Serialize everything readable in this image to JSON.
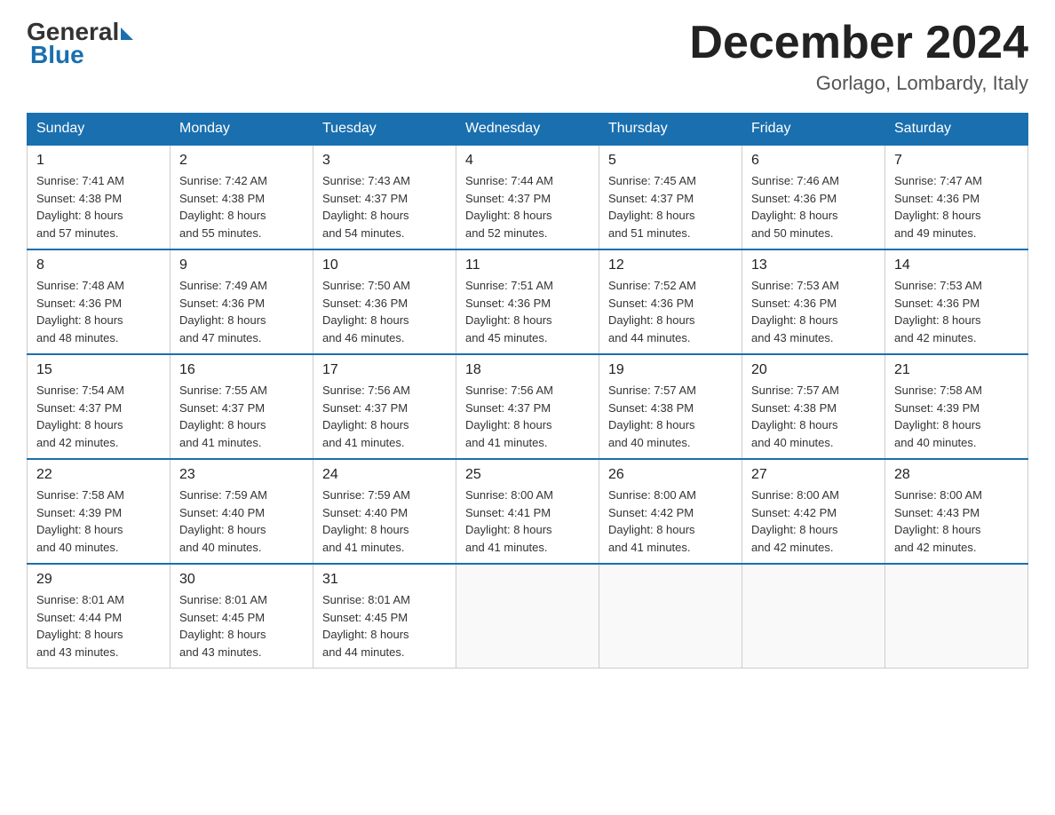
{
  "header": {
    "logo_general": "General",
    "logo_blue": "Blue",
    "month_title": "December 2024",
    "location": "Gorlago, Lombardy, Italy"
  },
  "days_of_week": [
    "Sunday",
    "Monday",
    "Tuesday",
    "Wednesday",
    "Thursday",
    "Friday",
    "Saturday"
  ],
  "weeks": [
    [
      {
        "num": "1",
        "sunrise": "7:41 AM",
        "sunset": "4:38 PM",
        "daylight": "8 hours and 57 minutes."
      },
      {
        "num": "2",
        "sunrise": "7:42 AM",
        "sunset": "4:38 PM",
        "daylight": "8 hours and 55 minutes."
      },
      {
        "num": "3",
        "sunrise": "7:43 AM",
        "sunset": "4:37 PM",
        "daylight": "8 hours and 54 minutes."
      },
      {
        "num": "4",
        "sunrise": "7:44 AM",
        "sunset": "4:37 PM",
        "daylight": "8 hours and 52 minutes."
      },
      {
        "num": "5",
        "sunrise": "7:45 AM",
        "sunset": "4:37 PM",
        "daylight": "8 hours and 51 minutes."
      },
      {
        "num": "6",
        "sunrise": "7:46 AM",
        "sunset": "4:36 PM",
        "daylight": "8 hours and 50 minutes."
      },
      {
        "num": "7",
        "sunrise": "7:47 AM",
        "sunset": "4:36 PM",
        "daylight": "8 hours and 49 minutes."
      }
    ],
    [
      {
        "num": "8",
        "sunrise": "7:48 AM",
        "sunset": "4:36 PM",
        "daylight": "8 hours and 48 minutes."
      },
      {
        "num": "9",
        "sunrise": "7:49 AM",
        "sunset": "4:36 PM",
        "daylight": "8 hours and 47 minutes."
      },
      {
        "num": "10",
        "sunrise": "7:50 AM",
        "sunset": "4:36 PM",
        "daylight": "8 hours and 46 minutes."
      },
      {
        "num": "11",
        "sunrise": "7:51 AM",
        "sunset": "4:36 PM",
        "daylight": "8 hours and 45 minutes."
      },
      {
        "num": "12",
        "sunrise": "7:52 AM",
        "sunset": "4:36 PM",
        "daylight": "8 hours and 44 minutes."
      },
      {
        "num": "13",
        "sunrise": "7:53 AM",
        "sunset": "4:36 PM",
        "daylight": "8 hours and 43 minutes."
      },
      {
        "num": "14",
        "sunrise": "7:53 AM",
        "sunset": "4:36 PM",
        "daylight": "8 hours and 42 minutes."
      }
    ],
    [
      {
        "num": "15",
        "sunrise": "7:54 AM",
        "sunset": "4:37 PM",
        "daylight": "8 hours and 42 minutes."
      },
      {
        "num": "16",
        "sunrise": "7:55 AM",
        "sunset": "4:37 PM",
        "daylight": "8 hours and 41 minutes."
      },
      {
        "num": "17",
        "sunrise": "7:56 AM",
        "sunset": "4:37 PM",
        "daylight": "8 hours and 41 minutes."
      },
      {
        "num": "18",
        "sunrise": "7:56 AM",
        "sunset": "4:37 PM",
        "daylight": "8 hours and 41 minutes."
      },
      {
        "num": "19",
        "sunrise": "7:57 AM",
        "sunset": "4:38 PM",
        "daylight": "8 hours and 40 minutes."
      },
      {
        "num": "20",
        "sunrise": "7:57 AM",
        "sunset": "4:38 PM",
        "daylight": "8 hours and 40 minutes."
      },
      {
        "num": "21",
        "sunrise": "7:58 AM",
        "sunset": "4:39 PM",
        "daylight": "8 hours and 40 minutes."
      }
    ],
    [
      {
        "num": "22",
        "sunrise": "7:58 AM",
        "sunset": "4:39 PM",
        "daylight": "8 hours and 40 minutes."
      },
      {
        "num": "23",
        "sunrise": "7:59 AM",
        "sunset": "4:40 PM",
        "daylight": "8 hours and 40 minutes."
      },
      {
        "num": "24",
        "sunrise": "7:59 AM",
        "sunset": "4:40 PM",
        "daylight": "8 hours and 41 minutes."
      },
      {
        "num": "25",
        "sunrise": "8:00 AM",
        "sunset": "4:41 PM",
        "daylight": "8 hours and 41 minutes."
      },
      {
        "num": "26",
        "sunrise": "8:00 AM",
        "sunset": "4:42 PM",
        "daylight": "8 hours and 41 minutes."
      },
      {
        "num": "27",
        "sunrise": "8:00 AM",
        "sunset": "4:42 PM",
        "daylight": "8 hours and 42 minutes."
      },
      {
        "num": "28",
        "sunrise": "8:00 AM",
        "sunset": "4:43 PM",
        "daylight": "8 hours and 42 minutes."
      }
    ],
    [
      {
        "num": "29",
        "sunrise": "8:01 AM",
        "sunset": "4:44 PM",
        "daylight": "8 hours and 43 minutes."
      },
      {
        "num": "30",
        "sunrise": "8:01 AM",
        "sunset": "4:45 PM",
        "daylight": "8 hours and 43 minutes."
      },
      {
        "num": "31",
        "sunrise": "8:01 AM",
        "sunset": "4:45 PM",
        "daylight": "8 hours and 44 minutes."
      },
      null,
      null,
      null,
      null
    ]
  ]
}
